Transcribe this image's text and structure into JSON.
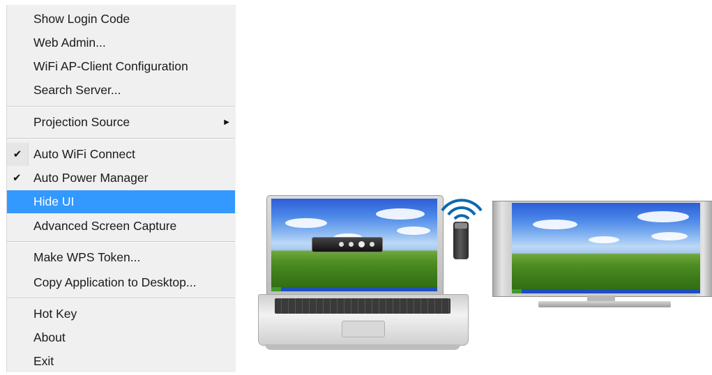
{
  "menu": {
    "items": [
      {
        "label": "Show Login Code"
      },
      {
        "label": "Web Admin..."
      },
      {
        "label": "WiFi AP-Client Configuration"
      },
      {
        "label": "Search Server..."
      },
      {
        "label": "Projection Source",
        "submenu": true
      },
      {
        "label": "Auto WiFi Connect",
        "checked": true
      },
      {
        "label": "Auto Power Manager",
        "checked": true
      },
      {
        "label": "Hide UI",
        "highlighted": true
      },
      {
        "label": "Advanced Screen Capture"
      },
      {
        "label": "Make WPS Token..."
      },
      {
        "label": "Copy Application to Desktop..."
      },
      {
        "label": "Hot Key"
      },
      {
        "label": "About"
      },
      {
        "label": "Exit"
      }
    ],
    "check_glyph": "✔",
    "submenu_glyph": "▶"
  },
  "icons": {
    "checkmark": "check-icon",
    "submenu": "submenu-arrow-icon",
    "wifi": "wifi-signal-icon",
    "dongle": "usb-dongle-icon",
    "laptop": "laptop-icon",
    "monitor": "monitor-icon"
  },
  "colors": {
    "menu_bg": "#f0f0f0",
    "highlight": "#3399ff",
    "wifi": "#0b68b0"
  }
}
